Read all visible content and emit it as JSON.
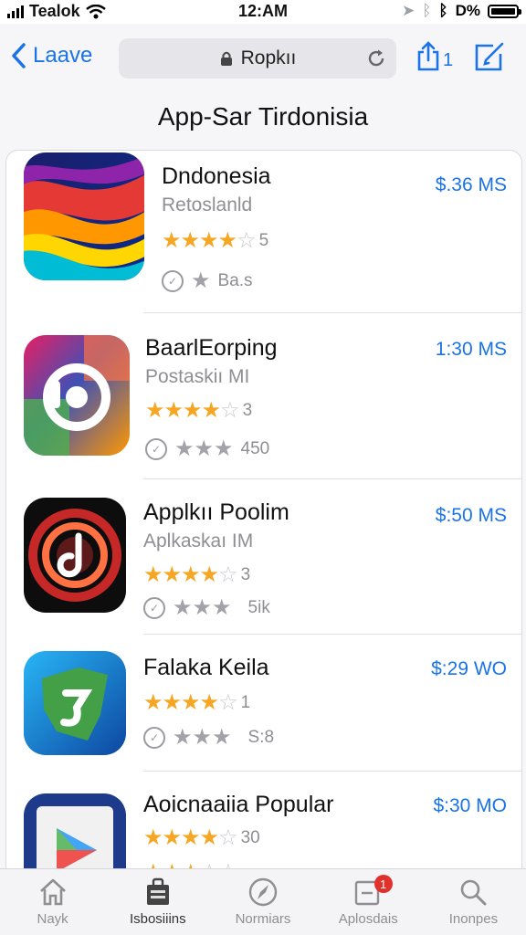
{
  "status_bar": {
    "carrier": "Tealok",
    "time": "12:AM",
    "battery_text": "D%"
  },
  "nav": {
    "back_label": "Laave",
    "url_text": "Ropkıı",
    "share_label": "1"
  },
  "page_title": "App-Sar Tirdonisia",
  "apps": [
    {
      "name": "Dndonesia",
      "subtitle": "Retoslanld",
      "stars": 4,
      "rating_count": "5",
      "meta": "Ba.s",
      "price": "$.36 MS",
      "icon": "wave-art-icon"
    },
    {
      "name": "BaarlEorping",
      "subtitle": "Postaskiı MI",
      "stars": 4,
      "rating_count": "3",
      "meta": "450",
      "price": "1:30 MS",
      "icon": "camera-app-icon"
    },
    {
      "name": "Applkıı Poolim",
      "subtitle": "Aplkaskaı IM",
      "stars": 4,
      "rating_count": "3",
      "meta": "5ik",
      "price": "$:50 MS",
      "icon": "music-app-icon"
    },
    {
      "name": "Falaka Keila",
      "subtitle": "",
      "stars": 4,
      "rating_count": "1",
      "meta": "S:8",
      "price": "$:29 WO",
      "icon": "green-leaf-app-icon"
    },
    {
      "name": "Aoicnaaiia Popular",
      "subtitle": "",
      "stars": 4,
      "rating_count": "30",
      "meta": "",
      "price": "$:30 MO",
      "icon": "play-app-icon"
    }
  ],
  "tabbar": {
    "tabs": [
      {
        "label": "Nayk",
        "icon": "home-icon"
      },
      {
        "label": "Isbosiiins",
        "icon": "bag-icon"
      },
      {
        "label": "Normiars",
        "icon": "compass-icon"
      },
      {
        "label": "Aplosdais",
        "icon": "updates-icon",
        "badge": "1"
      },
      {
        "label": "Inonpes",
        "icon": "search-icon"
      }
    ]
  },
  "colors": {
    "accent": "#1a73e8",
    "star": "#f5a623",
    "badge": "#e0322b"
  }
}
